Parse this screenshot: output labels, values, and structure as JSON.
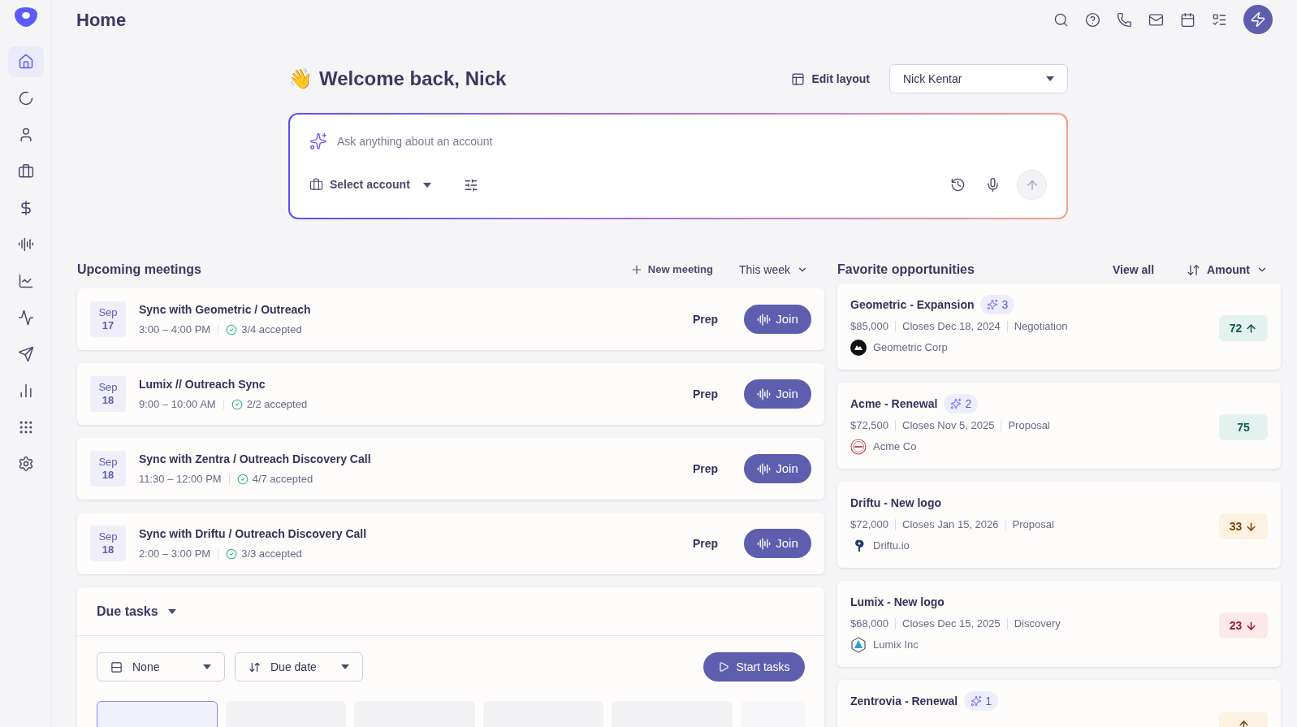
{
  "header": {
    "title": "Home"
  },
  "sidebar": {
    "items": [
      {
        "selected": true
      },
      {
        "selected": false
      },
      {
        "selected": false
      },
      {
        "selected": false
      },
      {
        "selected": false
      },
      {
        "selected": false
      },
      {
        "selected": false
      },
      {
        "selected": false
      },
      {
        "selected": false
      },
      {
        "selected": false
      },
      {
        "selected": false
      },
      {
        "selected": false
      }
    ]
  },
  "welcome": {
    "emoji": "👋",
    "title": "Welcome back, Nick",
    "edit_layout": "Edit layout",
    "user_select": "Nick Kentar"
  },
  "ask": {
    "placeholder": "Ask anything about an account",
    "select_account": "Select account"
  },
  "meetings": {
    "title": "Upcoming meetings",
    "new_meeting": "New meeting",
    "range": "This week",
    "items": [
      {
        "month": "Sep",
        "day": "17",
        "title": "Sync with Geometric / Outreach",
        "time": "3:00 – 4:00 PM",
        "accepted": "3/4 accepted",
        "prep": "Prep",
        "join": "Join"
      },
      {
        "month": "Sep",
        "day": "18",
        "title": "Lumix // Outreach Sync",
        "time": "9:00 – 10:00 AM",
        "accepted": "2/2 accepted",
        "prep": "Prep",
        "join": "Join"
      },
      {
        "month": "Sep",
        "day": "18",
        "title": "Sync with Zentra / Outreach Discovery Call",
        "time": "11:30 – 12:00 PM",
        "accepted": "4/7 accepted",
        "prep": "Prep",
        "join": "Join"
      },
      {
        "month": "Sep",
        "day": "18",
        "title": "Sync with Driftu / Outreach Discovery Call",
        "time": "2:00 – 3:00 PM",
        "accepted": "3/3 accepted",
        "prep": "Prep",
        "join": "Join"
      }
    ]
  },
  "tasks": {
    "title": "Due tasks",
    "group": "None",
    "sort": "Due date",
    "start": "Start tasks",
    "counts": [
      {
        "selected": true
      },
      {
        "selected": false
      },
      {
        "selected": false
      },
      {
        "selected": false
      },
      {
        "selected": false
      }
    ]
  },
  "opportunities": {
    "title": "Favorite opportunities",
    "view_all": "View all",
    "sort": "Amount",
    "items": [
      {
        "name": "Geometric - Expansion",
        "insights": "3",
        "amount": "$85,000",
        "closes": "Closes Dec 18, 2024",
        "stage": "Negotiation",
        "company": "Geometric Corp",
        "score": "72",
        "color": "#e3f2ef",
        "rising": true,
        "falling": false
      },
      {
        "name": "Acme - Renewal",
        "insights": "2",
        "amount": "$72,500",
        "closes": "Closes Nov 5, 2025",
        "stage": "Proposal",
        "company": "Acme Co",
        "score": "75",
        "color": "#e3f2ef",
        "rising": false,
        "falling": false
      },
      {
        "name": "Driftu - New logo",
        "amount": "$72,000",
        "closes": "Closes Jan 15, 2026",
        "stage": "Proposal",
        "company": "Driftu.io",
        "score": "33",
        "color": "#fdf1e2",
        "rising": false,
        "falling": true
      },
      {
        "name": "Lumix - New logo",
        "amount": "$68,000",
        "closes": "Closes Dec 15, 2025",
        "stage": "Discovery",
        "company": "Lumix Inc",
        "score": "23",
        "color": "#fde8ea",
        "rising": false,
        "falling": true
      },
      {
        "name": "Zentrovia - Renewal",
        "insights": "1",
        "color": "#fdf1e2",
        "rising": true,
        "falling": false
      }
    ]
  }
}
